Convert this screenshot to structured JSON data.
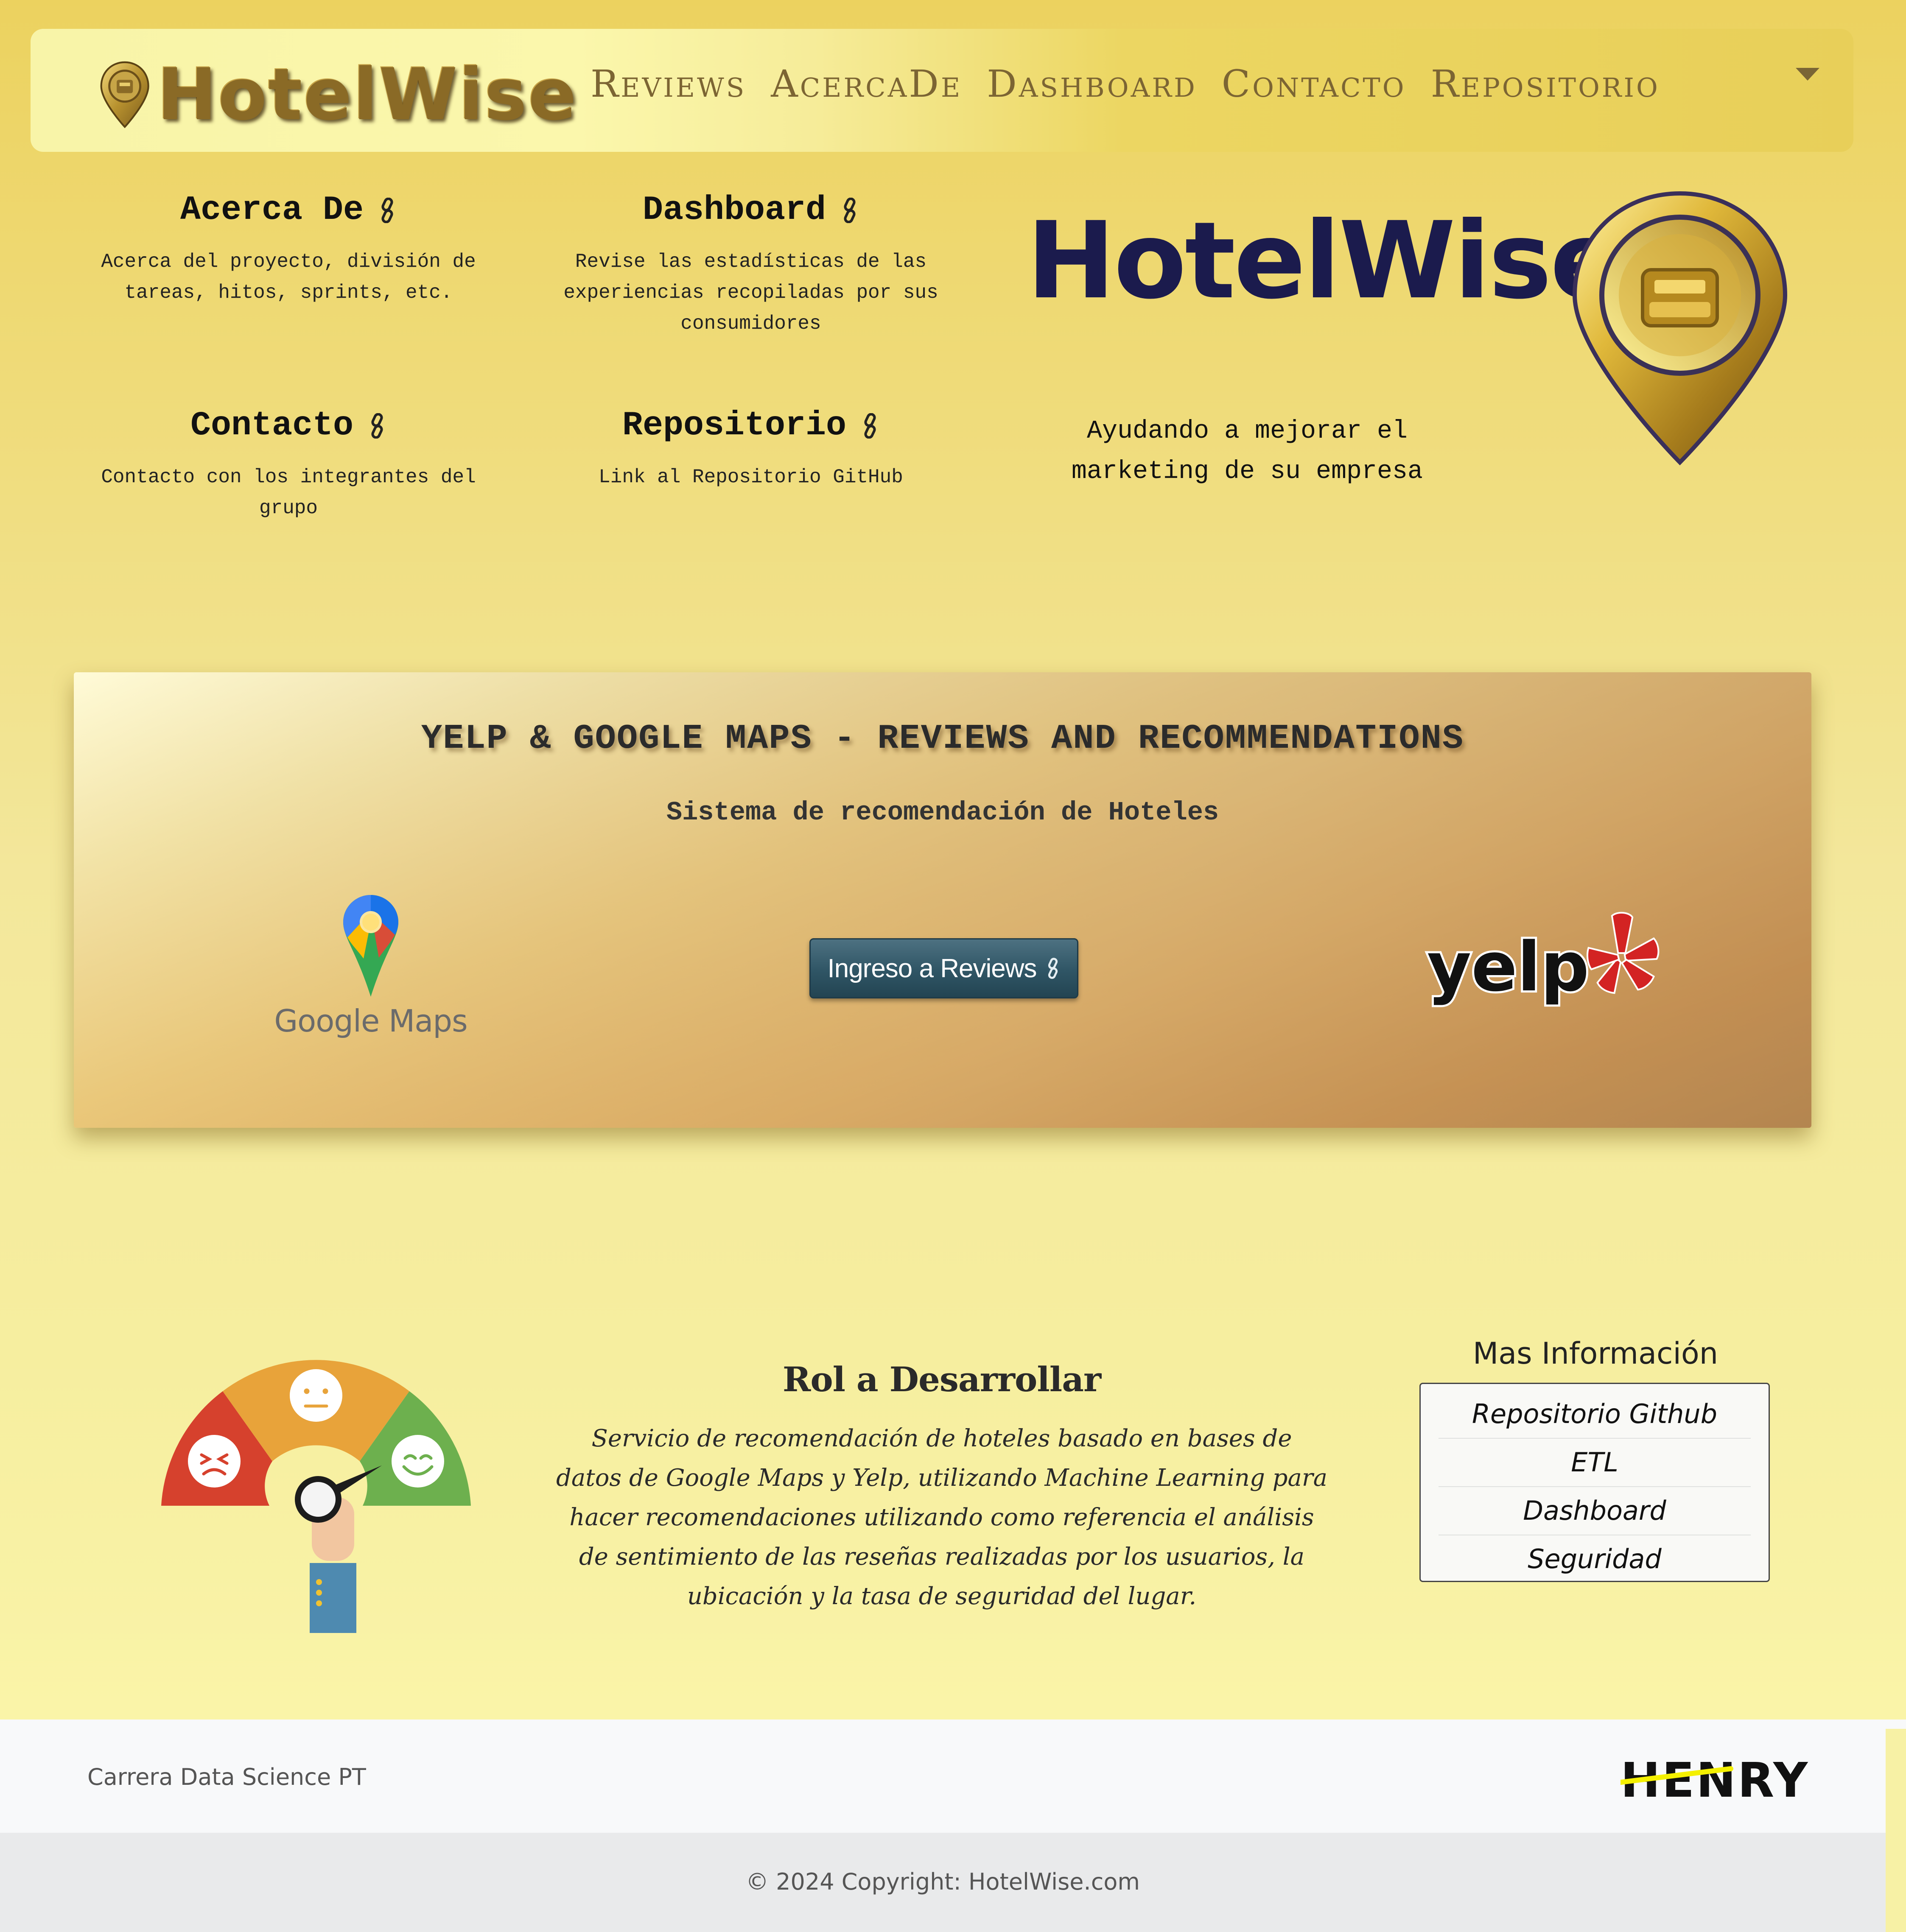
{
  "navbar": {
    "brand": "HotelWise",
    "links": [
      "Reviews",
      "AcercaDe",
      "Dashboard",
      "Contacto",
      "Repositorio"
    ],
    "dropdown_icon": "caret-down-icon"
  },
  "sections": {
    "acerca": {
      "title": "Acerca De",
      "desc": "Acerca del proyecto, división de\ntareas, hitos, sprints, etc."
    },
    "dashboard": {
      "title": "Dashboard",
      "desc": "Revise las estadísticas de las\nexperiencias recopiladas por sus\nconsumidores"
    },
    "contacto": {
      "title": "Contacto",
      "desc": "Contacto con los integrantes del\ngrupo"
    },
    "repositorio": {
      "title": "Repositorio",
      "desc": "Link al Repositorio GitHub"
    },
    "link_icon": "link-icon"
  },
  "hero": {
    "brand": "HotelWise",
    "tagline": "Ayudando a mejorar el marketing de su empresa",
    "pin_icon": "hotel-pin-icon"
  },
  "banner": {
    "title": "YELP & GOOGLE MAPS - REVIEWS AND RECOMMENDATIONS",
    "subtitle": "Sistema de recomendación de Hoteles",
    "google_maps_label": "Google Maps",
    "button_label": "Ingreso a Reviews",
    "yelp_label": "yelp"
  },
  "rol": {
    "title": "Rol a Desarrollar",
    "text": "Servicio de recomendación de hoteles basado en bases de datos de Google Maps y Yelp, utilizando Machine Learning para hacer recomendaciones utilizando como referencia el análisis de sentimiento de las reseñas realizadas por los usuarios, la ubicación y la tasa de seguridad del lugar."
  },
  "mas_info": {
    "title": "Mas Información",
    "items": [
      "Repositorio Github",
      "ETL",
      "Dashboard",
      "Seguridad"
    ]
  },
  "footer": {
    "left": "Carrera Data Science PT",
    "logo": "HENRY",
    "copyright": "© 2024 Copyright: HotelWise.com"
  },
  "colors": {
    "background": "#ecd25f",
    "brand_navy": "#1b1b4d",
    "nav_text": "#7c6533",
    "button": "#2f5565",
    "yelp_red": "#d32323"
  }
}
